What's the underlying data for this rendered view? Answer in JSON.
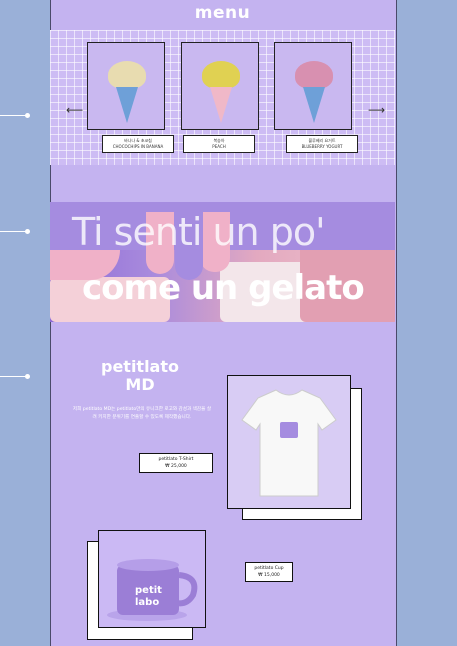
{
  "menu": {
    "title": "menu",
    "prev_icon": "arrow-left-icon",
    "next_icon": "arrow-right-icon",
    "items": [
      {
        "kr": "바나나 & 초코칩",
        "en": "CHOCOCHIPS IN BANANA",
        "scoop_color": "#e8dcb0"
      },
      {
        "kr": "복숭아",
        "en": "PEACH",
        "scoop_color": "#e0d152"
      },
      {
        "kr": "블루베리 요거트",
        "en": "BLUEBERRY YOGURT",
        "scoop_color": "#d890b0"
      }
    ]
  },
  "banner": {
    "line1": "Ti senti un po'",
    "line2": "come un gelato"
  },
  "md": {
    "title": "petitlato\nMD",
    "description": "저희 petitlato MD는 petitlato만의 유니크한 로고와 감성과 색감을 살려 키치한 분위기를 연출할 수 있도록 제작했습니다.",
    "products": [
      {
        "name": "petitlato T-Shirt",
        "price": "₩ 25,000"
      },
      {
        "name": "petitlato Cup",
        "price": "₩ 15,000"
      }
    ],
    "logo_text": "petit labo"
  },
  "colors": {
    "background": "#9ab0d8",
    "page": "#c4b3f0",
    "accent": "#a58ce0"
  }
}
